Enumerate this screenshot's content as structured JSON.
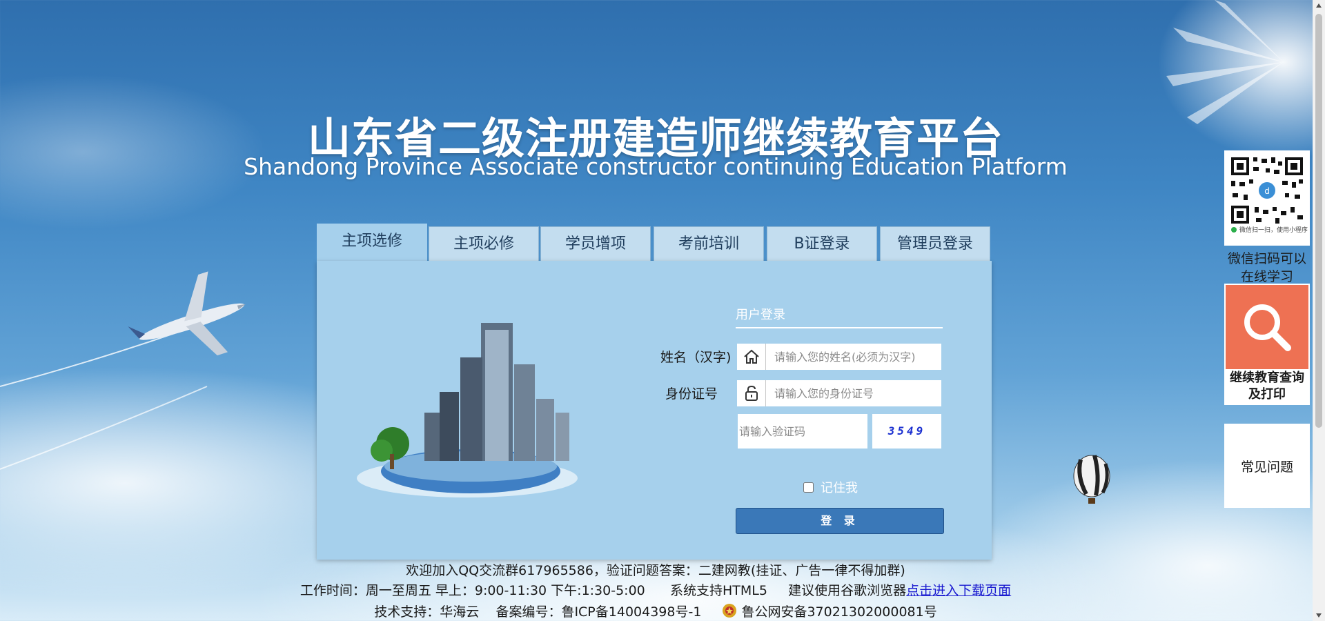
{
  "header": {
    "title": "山东省二级注册建造师继续教育平台",
    "subtitle": "Shandong Province Associate constructor continuing Education Platform"
  },
  "tabs": [
    {
      "label": "主项选修",
      "active": true
    },
    {
      "label": "主项必修",
      "active": false
    },
    {
      "label": "学员增项",
      "active": false
    },
    {
      "label": "考前培训",
      "active": false
    },
    {
      "label": "B证登录",
      "active": false
    },
    {
      "label": "管理员登录",
      "active": false
    }
  ],
  "login": {
    "title": "用户登录",
    "name_label": "姓名（汉字)",
    "name_placeholder": "请输入您的姓名(必须为汉字)",
    "id_label": "身份证号",
    "id_placeholder": "请输入您的身份证号",
    "captcha_placeholder": "请输入验证码",
    "captcha_code": "3549",
    "remember_label": "记住我",
    "submit_label": "登 录"
  },
  "footer": {
    "line1": "欢迎加入QQ交流群617965586，验证问题答案：二建网教(挂证、广告一律不得加群)",
    "line2_text": "工作时间：周一至周五 早上：9:00-11:30 下午:1:30-5:00      系统支持HTML5     建议使用谷歌浏览器",
    "line2_link": "点击进入下载页面",
    "line3_support": "技术支持：华海云    备案编号：鲁ICP备14004398号-1",
    "line3_police": "鲁公网安备37021302000081号"
  },
  "sidebar": {
    "qr_caption_small": "微信扫一扫，使用小程序",
    "qr_label": "微信扫码可以在线学习",
    "search_label": "继续教育查询及打印",
    "faq_label": "常见问题"
  },
  "colors": {
    "tab_bg": "#c3ddef",
    "panel_bg": "#a6d0ec",
    "button_bg": "#3a78b8",
    "search_tile": "#ee7153",
    "captcha_text": "#1a2fd0",
    "link": "#1a1ad0"
  },
  "icons": {
    "name_field": "home-icon",
    "id_field": "lock-icon",
    "search_tile": "magnifier-icon",
    "police_badge": "police-badge-icon"
  }
}
